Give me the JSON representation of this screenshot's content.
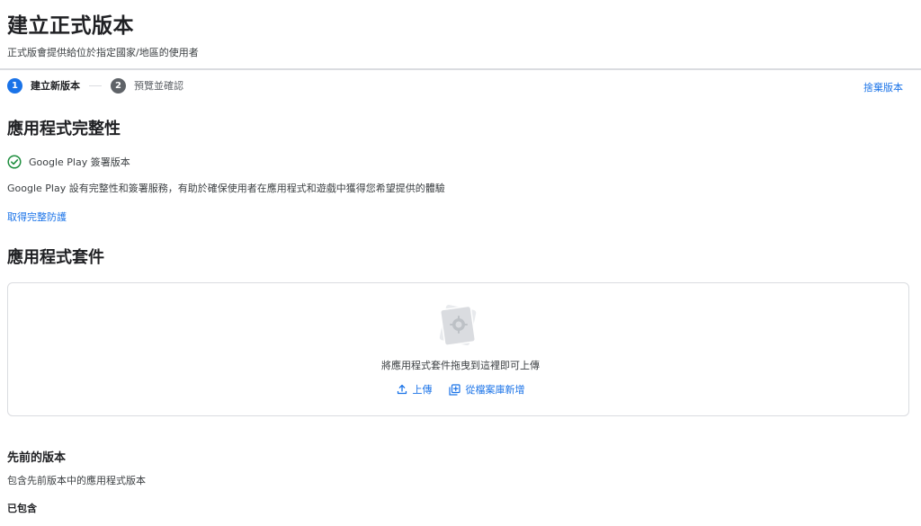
{
  "header": {
    "title": "建立正式版本",
    "subtitle": "正式版會提供給位於指定國家/地區的使用者"
  },
  "stepper": {
    "steps": [
      {
        "number": "1",
        "label": "建立新版本"
      },
      {
        "number": "2",
        "label": "預覽並確認"
      }
    ],
    "discard_label": "捨棄版本"
  },
  "integrity": {
    "title": "應用程式完整性",
    "status_label": "Google Play 簽署版本",
    "description": "Google Play 設有完整性和簽署服務，有助於確保使用者在應用程式和遊戲中獲得您希望提供的體驗",
    "link_label": "取得完整防護"
  },
  "bundles": {
    "title": "應用程式套件",
    "drop_text": "將應用程式套件拖曳到這裡即可上傳",
    "upload_label": "上傳",
    "library_label": "從檔案庫新增"
  },
  "previous": {
    "title": "先前的版本",
    "description": "包含先前版本中的應用程式版本",
    "included_label": "已包含"
  },
  "colors": {
    "accent": "#1a73e8",
    "success": "#1e8e3e",
    "step_inactive": "#5f6368"
  },
  "icons": [
    "check-circle-icon",
    "upload-icon",
    "library-add-icon",
    "app-bundle-illustration"
  ]
}
